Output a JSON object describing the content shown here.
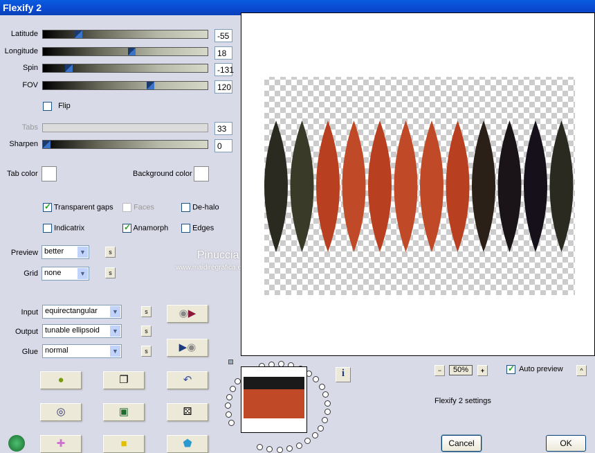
{
  "window": {
    "title": "Flexify 2"
  },
  "sliders": [
    {
      "label": "Latitude",
      "value": "-55",
      "fraction": 0.2
    },
    {
      "label": "Longitude",
      "value": "18",
      "fraction": 0.54
    },
    {
      "label": "Spin",
      "value": "-131",
      "fraction": 0.14
    },
    {
      "label": "FOV",
      "value": "120",
      "fraction": 0.66
    }
  ],
  "flip": {
    "label": "Flip",
    "checked": false
  },
  "tabs": {
    "label": "Tabs",
    "value": "33",
    "disabled": true
  },
  "sharpen": {
    "label": "Sharpen",
    "value": "0",
    "fraction": 0
  },
  "colors": {
    "tab_color_label": "Tab color",
    "background_color_label": "Background color",
    "tab_color": "#ffffff",
    "background_color": "#ffffff"
  },
  "options": {
    "transparent_gaps": "Transparent gaps",
    "faces": "Faces",
    "de_halo": "De-halo",
    "indicatrix": "Indicatrix",
    "anamorph": "Anamorph",
    "edges": "Edges"
  },
  "preview": {
    "label": "Preview",
    "value": "better"
  },
  "grid": {
    "label": "Grid",
    "value": "none"
  },
  "input": {
    "label": "Input",
    "value": "equirectangular"
  },
  "output": {
    "label": "Output",
    "value": "tunable ellipsoid"
  },
  "glue": {
    "label": "Glue",
    "value": "normal"
  },
  "s_label": "s",
  "watermark": {
    "name": "Pinuccia",
    "url": "www.maidiregrafica.eu"
  },
  "zoom": {
    "minus": "−",
    "value": "50%",
    "plus": "+"
  },
  "auto_preview": {
    "label": "Auto preview",
    "checked": true
  },
  "collapse": "^",
  "info": "i",
  "settings_name": "Flexify 2 settings",
  "cancel": "Cancel",
  "ok": "OK"
}
